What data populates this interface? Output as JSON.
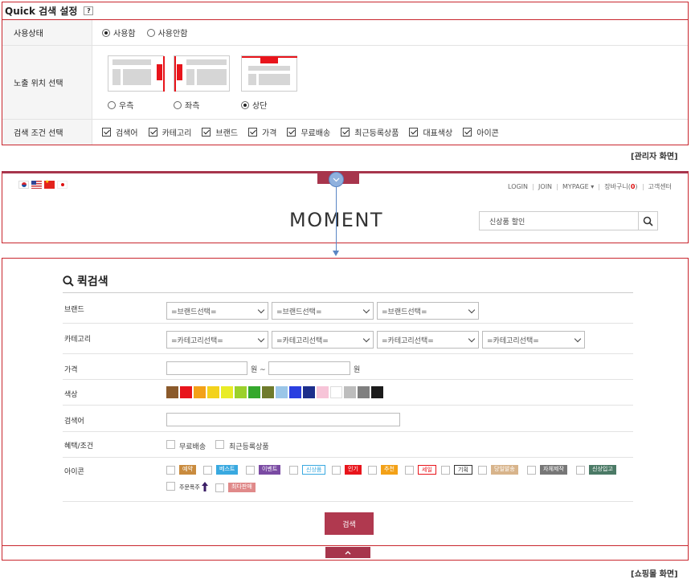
{
  "admin": {
    "title": "Quick 검색 설정",
    "help": "?",
    "rows": {
      "status": {
        "label": "사용상태",
        "options": [
          {
            "label": "사용함",
            "selected": true
          },
          {
            "label": "사용안함",
            "selected": false
          }
        ]
      },
      "position": {
        "label": "노출 위치 선택",
        "options": [
          {
            "label": "우측",
            "selected": false
          },
          {
            "label": "좌측",
            "selected": false
          },
          {
            "label": "상단",
            "selected": true
          }
        ]
      },
      "conditions": {
        "label": "검색 조건 선택",
        "options": [
          "검색어",
          "카테고리",
          "브랜드",
          "가격",
          "무료배송",
          "최근등록상품",
          "대표색상",
          "아이콘"
        ]
      }
    }
  },
  "captions": {
    "admin": "[관리자 화면]",
    "shop": "[쇼핑몰 화면]"
  },
  "shop": {
    "topnav": [
      "LOGIN",
      "JOIN",
      "MYPAGE ▾"
    ],
    "cart_label": "장바구니(",
    "cart_count": "0",
    "cart_close": ")",
    "service": "고객센터",
    "logo": "MOMENT",
    "search_value": "신상품 할인"
  },
  "quick": {
    "title": "퀵검색",
    "brand": {
      "label": "브랜드",
      "selects": [
        "=브랜드선택=",
        "=브랜드선택=",
        "=브랜드선택="
      ]
    },
    "category": {
      "label": "카테고리",
      "selects": [
        "=카테고리선택=",
        "=카테고리선택=",
        "=카테고리선택=",
        "=카테고리선택="
      ]
    },
    "price": {
      "label": "가격",
      "unit_from": "원 ~",
      "unit_to": "원"
    },
    "color": {
      "label": "색상",
      "swatches": [
        "#8b5a2b",
        "#e8141b",
        "#f3a117",
        "#f3d21c",
        "#e9ec26",
        "#9bd12b",
        "#35a82d",
        "#6f7b2b",
        "#9ac6e8",
        "#2a3fe0",
        "#1c2e8c",
        "#f7c4d8",
        "#ffffff",
        "#bdbdbd",
        "#7f7f7f",
        "#1b1b1b"
      ]
    },
    "keyword": {
      "label": "검색어"
    },
    "benefit": {
      "label": "혜택/조건",
      "options": [
        "무료배송",
        "최근등록상품"
      ]
    },
    "icon": {
      "label": "아이콘",
      "badges": [
        {
          "text": "예약",
          "bg": "#c98b3e",
          "fg": "#ffffff"
        },
        {
          "text": "베스트",
          "bg": "#39a9e0",
          "fg": "#ffffff"
        },
        {
          "text": "이벤트",
          "bg": "#7a4aa3",
          "fg": "#ffffff"
        },
        {
          "text": "신상품",
          "bg": "#ffffff",
          "fg": "#39a9e0"
        },
        {
          "text": "인기",
          "bg": "#e8141b",
          "fg": "#ffffff"
        },
        {
          "text": "추천",
          "bg": "#f3a117",
          "fg": "#ffffff"
        },
        {
          "text": "세일",
          "bg": "#ffffff",
          "fg": "#e8141b"
        },
        {
          "text": "기획",
          "bg": "#ffffff",
          "fg": "#333333"
        },
        {
          "text": "당일발송",
          "bg": "#d8b48b",
          "fg": "#ffffff"
        },
        {
          "text": "자체제작",
          "bg": "#777777",
          "fg": "#ffffff"
        },
        {
          "text": "신상입고",
          "bg": "#4b7a66",
          "fg": "#ffffff"
        }
      ],
      "special_label": "주문폭주",
      "last_badge": {
        "text": "최다판매",
        "bg": "#e08a8a",
        "fg": "#ffffff"
      }
    },
    "submit": "검색",
    "collapse": "^"
  },
  "colors": {
    "accent": "#c9262e",
    "button": "#b0394f",
    "tab": "#a7354c",
    "connector": "#5a86c4"
  }
}
